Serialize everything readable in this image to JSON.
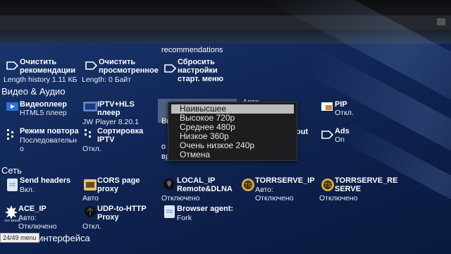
{
  "top_cut": "recommendations",
  "row1": [
    {
      "title": "Очистить\nрекомендации",
      "sub": "Length history 1.11 КБ"
    },
    {
      "title": "Очистить\nпросмотренное",
      "sub": "Length: 0 Байт"
    },
    {
      "title": "Сбросить\nнастройки\nстарт. меню",
      "sub": ""
    }
  ],
  "section_video": "Видео & Аудио",
  "video_items": [
    {
      "title": "Видеоплеер",
      "sub": "HTML5 плеер"
    },
    {
      "title": "IPTV+HLS\nплеер",
      "sub": "JW Player 8.20.1"
    },
    {
      "title": "PIP",
      "sub": "Откл."
    },
    {
      "title": "Режим повтора",
      "sub": "Последовательн\nо"
    },
    {
      "title": "Сортировка\nIPTV",
      "sub": "Откл."
    },
    {
      "title": "Ads",
      "sub": "On"
    }
  ],
  "hidden_bits": {
    "left_cut": "Вы",
    "left_cut2": "вр",
    "right_cut": "out",
    "top_cut2": "Авто ..."
  },
  "popup": {
    "options": [
      "Наивысшее",
      "Высокое 720p",
      "Среднее 480p",
      "Низкое 360p",
      "Очень низкое 240p",
      "Отмена"
    ],
    "selected_index": 0
  },
  "section_network": "Сеть",
  "network_items": [
    {
      "title": "Send headers",
      "sub": "Вкл."
    },
    {
      "title": "CORS page\nproxy",
      "sub": "Авто"
    },
    {
      "title": "LOCAL_IP\nRemote&DLNA",
      "sub": "Отключено"
    },
    {
      "title": "TORRSERVE_IP",
      "sub": "Авто:\nОтключено"
    },
    {
      "title": "TORRSERVE_RE\nSERVE",
      "sub": "Отключено"
    },
    {
      "title": "ACE_IP",
      "sub": "Авто:\nОтключено",
      "logo_text": "Ace Stream"
    },
    {
      "title": "UDP-to-HTTP\nProxy",
      "sub": "Откл."
    },
    {
      "title": "Browser agent:",
      "sub": "Fork"
    }
  ],
  "section_interface_cut": "йка интерфейса",
  "pager": "24/49 menu",
  "colors": {
    "popup_bg": "#1d1d1f",
    "popup_selected": "#bcbcbc",
    "bg_dark": "#0d1f4a",
    "bg_light": "#1c3a73"
  }
}
